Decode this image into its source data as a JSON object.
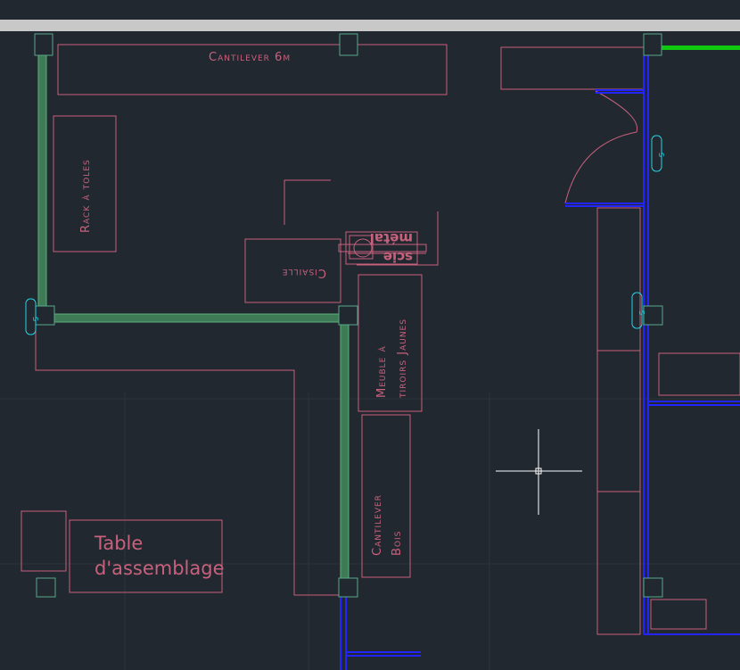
{
  "drawing": {
    "labels": {
      "cantilever_6m": "Cantilever 6m",
      "rack_toles": "Rack à toles",
      "cisaille": "Cisaille",
      "scie_metal_line1": "scie",
      "scie_metal_line2": "métal",
      "meuble_line1": "Meuble à",
      "meuble_line2": "tiroirs Jaunes",
      "cantilever_bois_line1": "Cantilever",
      "cantilever_bois_line2": "Bois",
      "table_line1": "Table",
      "table_line2": "d'assemblage",
      "switch_mark": "S"
    },
    "colors": {
      "background": "#212830",
      "furniture": "#c8617c",
      "wall_fill": "#3d7a55",
      "wall_edge": "#5fb07c",
      "blue_wall": "#2424ff",
      "column": "#57a88a",
      "green_line": "#11c811",
      "switch": "#22d3e6",
      "grid": "#2c343d",
      "crosshair": "#ffffff",
      "top_bar": "#c8c8c8"
    }
  }
}
